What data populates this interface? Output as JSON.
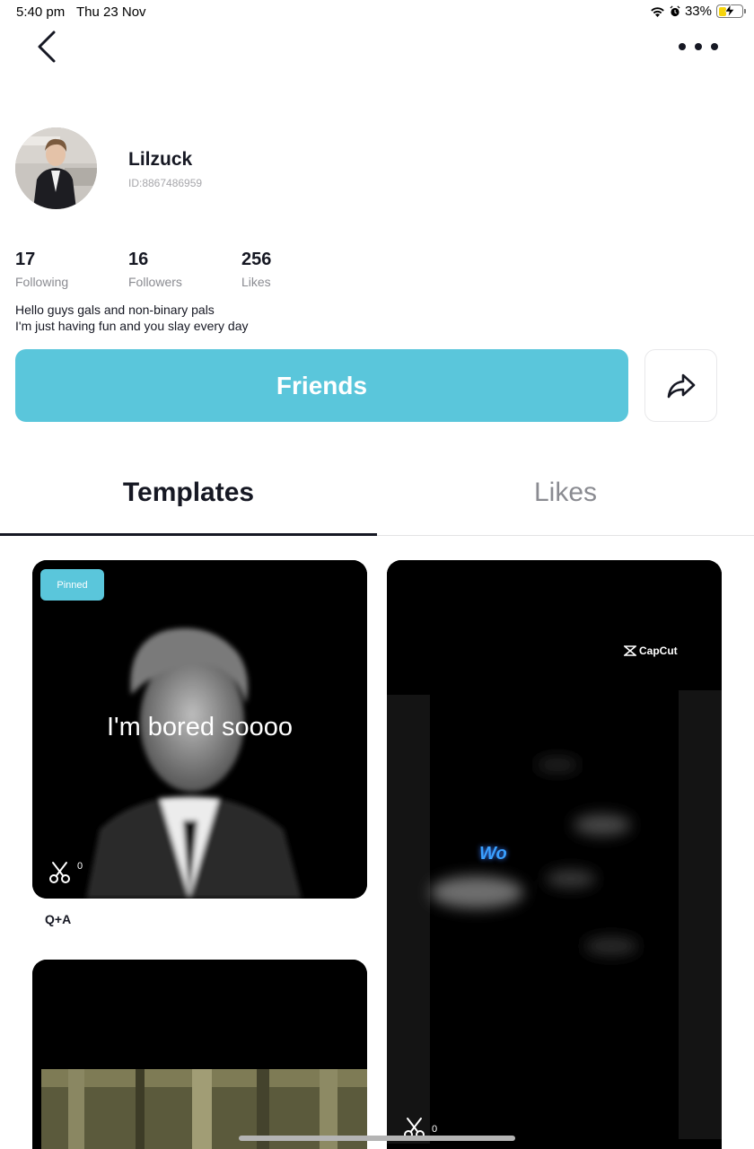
{
  "status_bar": {
    "time": "5:40 pm",
    "date": "Thu 23 Nov",
    "battery_text": "33%",
    "battery_level": 0.33,
    "icons": [
      "wifi-icon",
      "alarm-icon",
      "battery-charging-icon"
    ]
  },
  "nav": {
    "back_icon": "chevron-left-icon",
    "more_icon": "more-dots-icon"
  },
  "profile": {
    "username": "Lilzuck",
    "user_id": "ID:8867486959",
    "stats": [
      {
        "value": "17",
        "label": "Following"
      },
      {
        "value": "16",
        "label": "Followers"
      },
      {
        "value": "256",
        "label": "Likes"
      }
    ],
    "bio_lines": [
      "Hello guys gals and non-binary pals",
      "I'm just having fun and you slay every day"
    ]
  },
  "actions": {
    "friends_label": "Friends",
    "share_icon": "share-arrow-icon"
  },
  "tabs": [
    {
      "label": "Templates",
      "active": true
    },
    {
      "label": "Likes",
      "active": false
    }
  ],
  "templates": [
    {
      "badge": "Pinned",
      "overlay_text": "I'm bored soooo",
      "cut_count": "0",
      "title": "Q+A"
    },
    {
      "watermark": "CapCut",
      "overlay_text": "Wo",
      "cut_count": "0"
    },
    {}
  ],
  "colors": {
    "accent": "#5ac6db",
    "text_primary": "#161823",
    "text_secondary": "#8a8b91"
  }
}
